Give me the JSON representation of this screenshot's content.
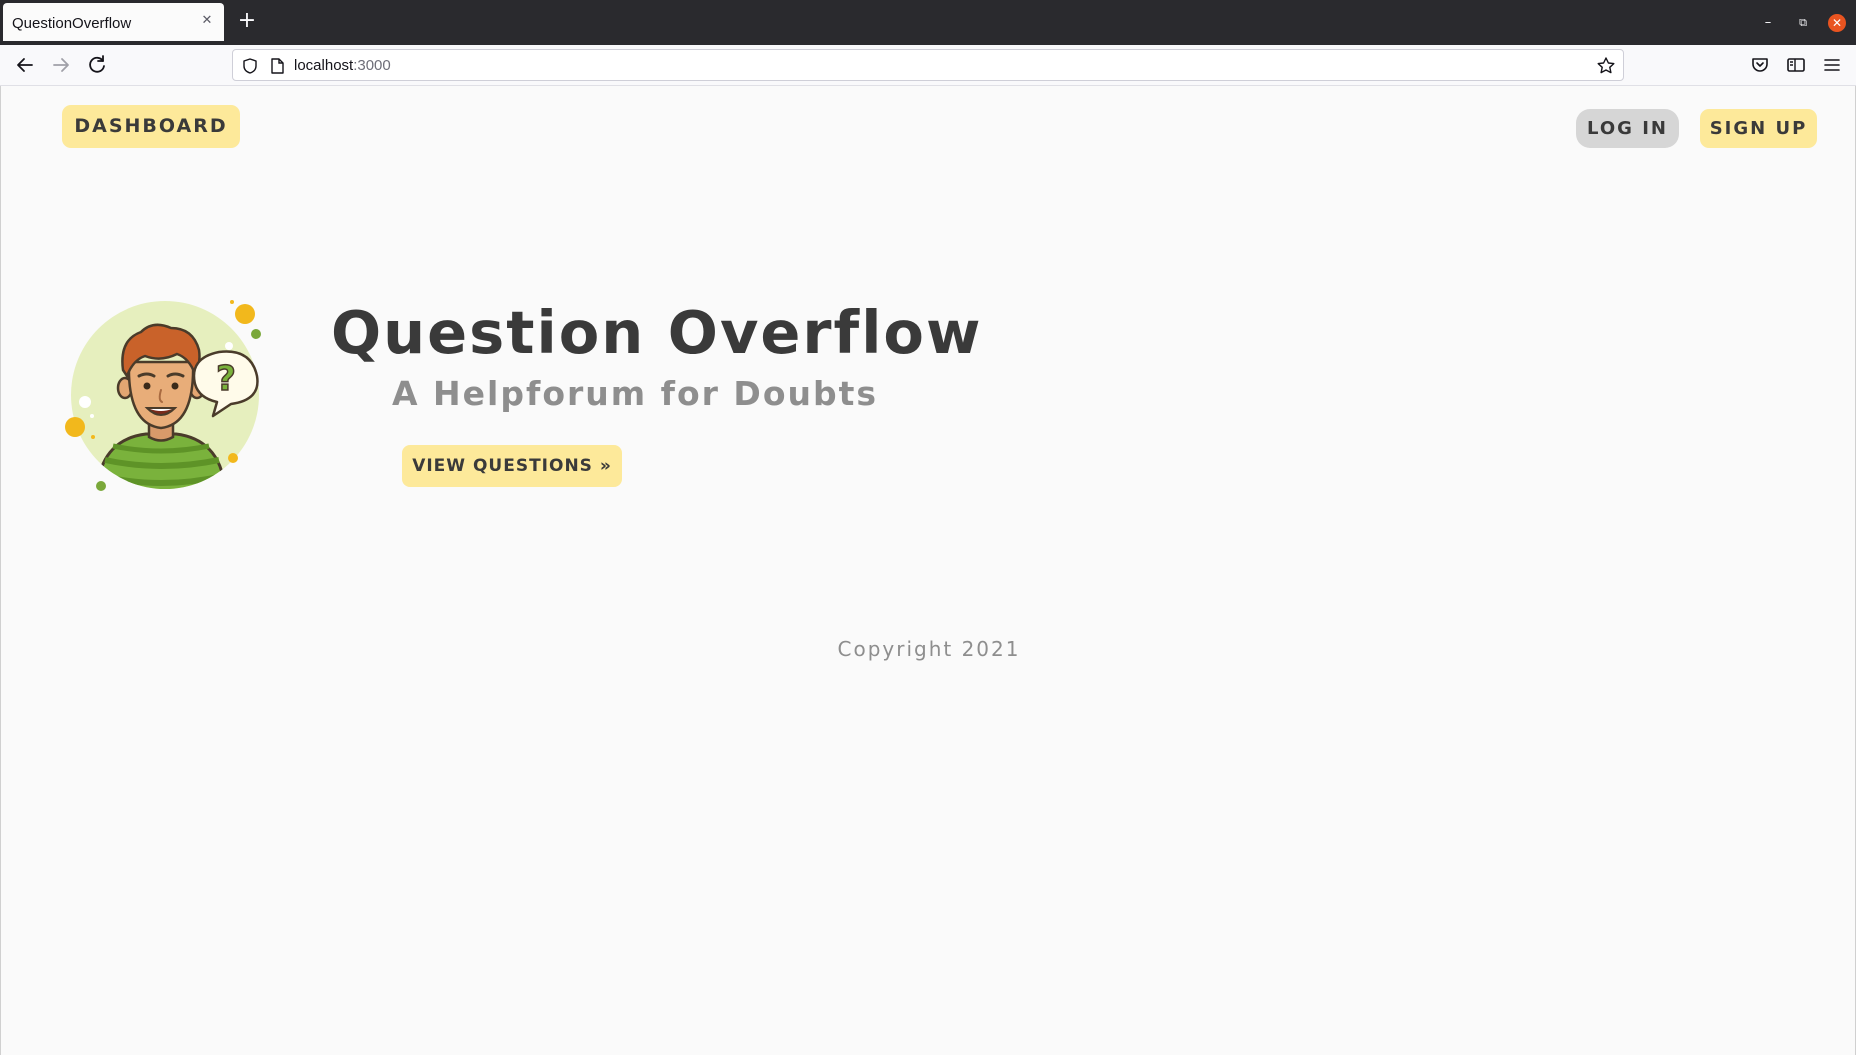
{
  "browser": {
    "tab_title": "QuestionOverflow",
    "tab_close_glyph": "✕",
    "new_tab_glyph": "+",
    "url_host": "localhost",
    "url_port": ":3000",
    "window_minimize_glyph": "–",
    "window_restore_glyph": "⧉",
    "window_close_glyph": "✕"
  },
  "header": {
    "dashboard_label": "DASHBOARD",
    "login_label": "LOG IN",
    "signup_label": "SIGN UP"
  },
  "hero": {
    "title": "Question Overflow",
    "subtitle": "A Helpforum for Doubts",
    "cta_label": "VIEW QUESTIONS »"
  },
  "footer": {
    "copyright": "Copyright 2021"
  },
  "colors": {
    "accent_yellow": "#fde99a",
    "button_gray": "#d6d6d6",
    "text_dark": "#3a3a3a",
    "text_muted": "#8e8e8e"
  }
}
